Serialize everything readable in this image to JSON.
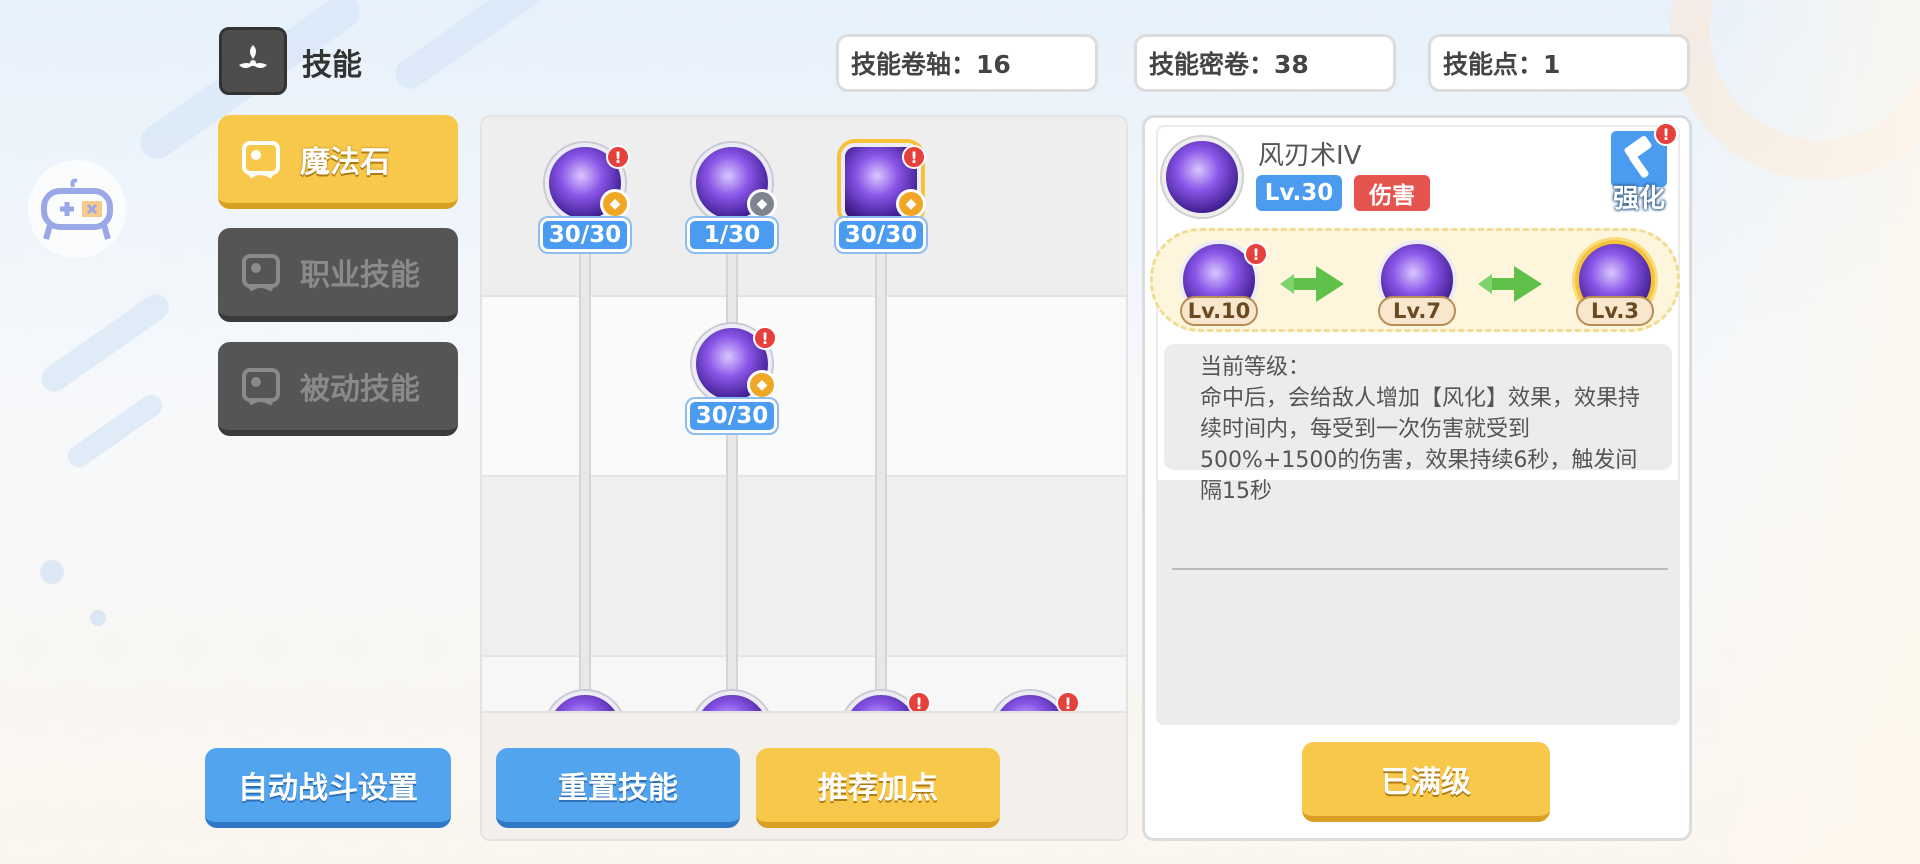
{
  "header": {
    "title": "技能",
    "title_icon": "skill-glyph-icon",
    "stats": [
      {
        "label": "技能卷轴：16"
      },
      {
        "label": "技能密卷：38"
      },
      {
        "label": "技能点：1"
      }
    ]
  },
  "tabs": [
    {
      "label": "魔法石",
      "active": true,
      "icon": "magic-stone-icon"
    },
    {
      "label": "职业技能",
      "active": false,
      "icon": "class-skill-icon"
    },
    {
      "label": "被动技能",
      "active": false,
      "icon": "passive-skill-icon"
    }
  ],
  "tree": {
    "nodes": [
      {
        "level": "30/30",
        "alert": "!",
        "badge": "gold"
      },
      {
        "level": "1/30",
        "alert": "",
        "badge": "gray"
      },
      {
        "level": "30/30",
        "alert": "!",
        "badge": "gold",
        "selected": true
      },
      {
        "level": "30/30",
        "alert": "!",
        "badge": "gold"
      }
    ],
    "bottom_alerts": [
      "!",
      "!"
    ]
  },
  "buttons": {
    "auto_battle": "自动战斗设置",
    "reset": "重置技能",
    "recommend": "推荐加点",
    "maxed": "已满级"
  },
  "detail": {
    "skill_name": "风刃术IV",
    "level_tag": "Lv.30",
    "type_tag": "伤害",
    "enhance_label": "强化",
    "enhance_alert": "!",
    "upgrade_path": [
      {
        "level": "Lv.10",
        "alert": "!"
      },
      {
        "level": "Lv.7"
      },
      {
        "level": "Lv.3",
        "highlight": true
      }
    ],
    "current_level_label": "当前等级：",
    "description": "命中后，会给敌人增加【风化】效果，效果持续时间内，每受到一次伤害就受到500%+1500的伤害，效果持续6秒，触发间隔15秒"
  },
  "colors": {
    "accent_yellow": "#f7c84a",
    "accent_blue": "#52a4ee",
    "alert_red": "#e5403b",
    "damage_red": "#e5544e"
  }
}
